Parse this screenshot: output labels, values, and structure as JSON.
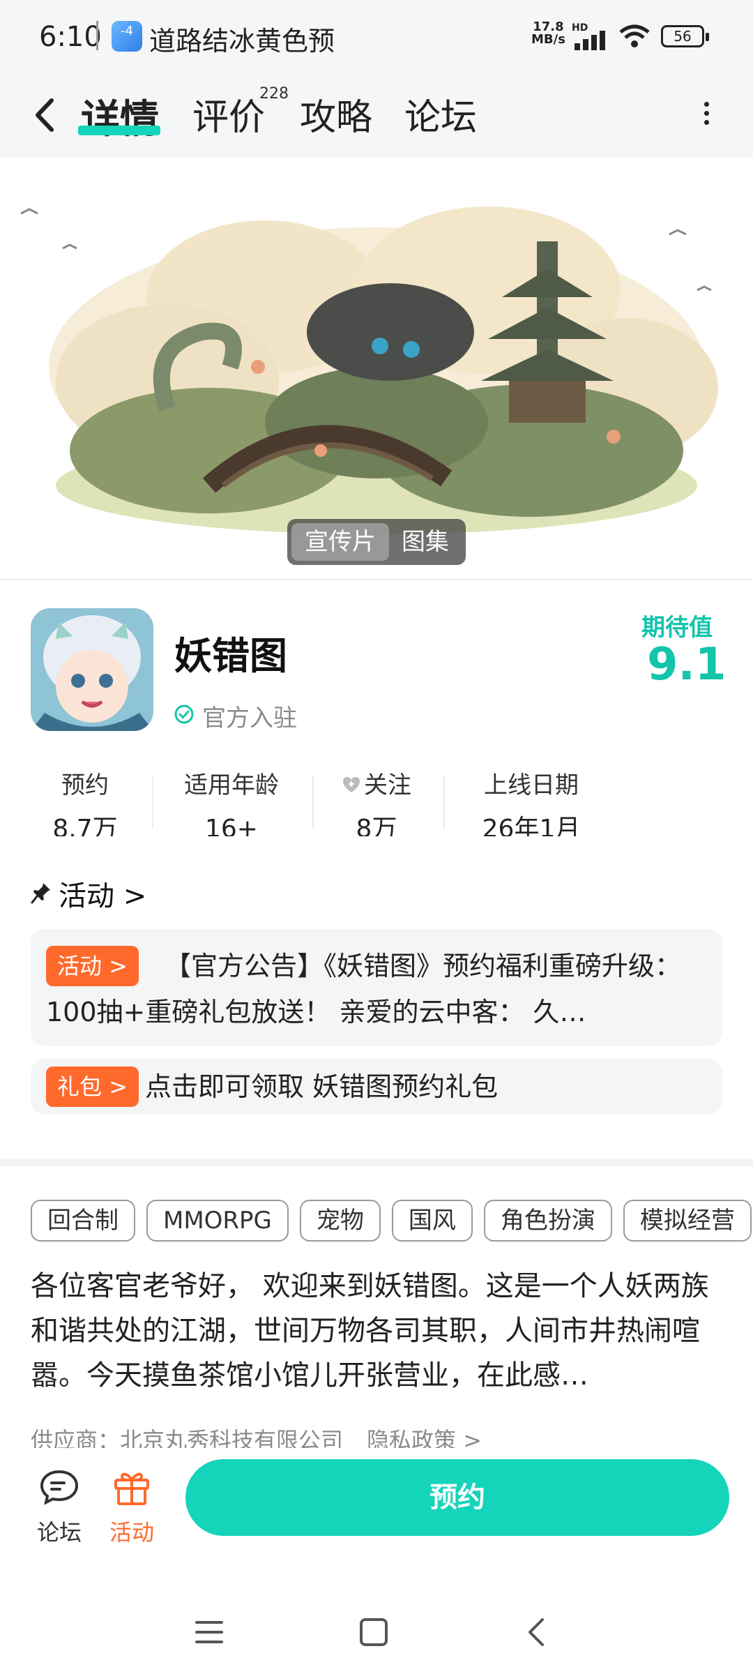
{
  "status_bar": {
    "time": "6:10",
    "app_icon_text": "-4",
    "notification": "道路结冰黄色预",
    "net_speed_value": "17.8",
    "net_speed_unit": "MB/s",
    "hd_label": "HD",
    "battery": "56"
  },
  "header": {
    "tabs": [
      {
        "label": "详情"
      },
      {
        "label": "评价"
      },
      {
        "label": "攻略"
      },
      {
        "label": "论坛"
      }
    ],
    "review_count": "228"
  },
  "media": {
    "options": [
      "宣传片",
      "图集"
    ],
    "selected": "宣传片"
  },
  "game": {
    "title": "妖错图",
    "verified": "官方入驻",
    "expect_label": "期待值",
    "expect_value": "9.1"
  },
  "stats": [
    {
      "label": "预约",
      "value": "8.7万"
    },
    {
      "label": "适用年龄",
      "value": "16+"
    },
    {
      "label": "关注",
      "value": "8万"
    },
    {
      "label": "上线日期",
      "value": "26年1月"
    }
  ],
  "activity": {
    "title": "活动 >",
    "event_badge": "活动 >",
    "event_text": "【官方公告】《妖错图》预约福利重磅升级：100抽+重磅礼包放送！ 亲爱的云中客： 久…",
    "gift_badge": "礼包 >",
    "gift_text": "点击即可领取 妖错图预约礼包"
  },
  "tags": [
    "回合制",
    "MMORPG",
    "宠物",
    "国风",
    "角色扮演",
    "模拟经营"
  ],
  "description": "各位客官老爷好， 欢迎来到妖错图。这是一个人妖两族和谐共处的江湖，世间万物各司其职，人间市井热闹喧嚣。今天摸鱼茶馆小馆儿开张营业，在此感…",
  "supplier": "供应商：北京丸秀科技有限公司",
  "privacy": "隐私政策 >",
  "bottom_bar": {
    "forum_label": "论坛",
    "activity_label": "活动",
    "reserve_label": "预约"
  },
  "colors": {
    "accent": "#14d4b9",
    "badge": "#ff6a2c"
  }
}
